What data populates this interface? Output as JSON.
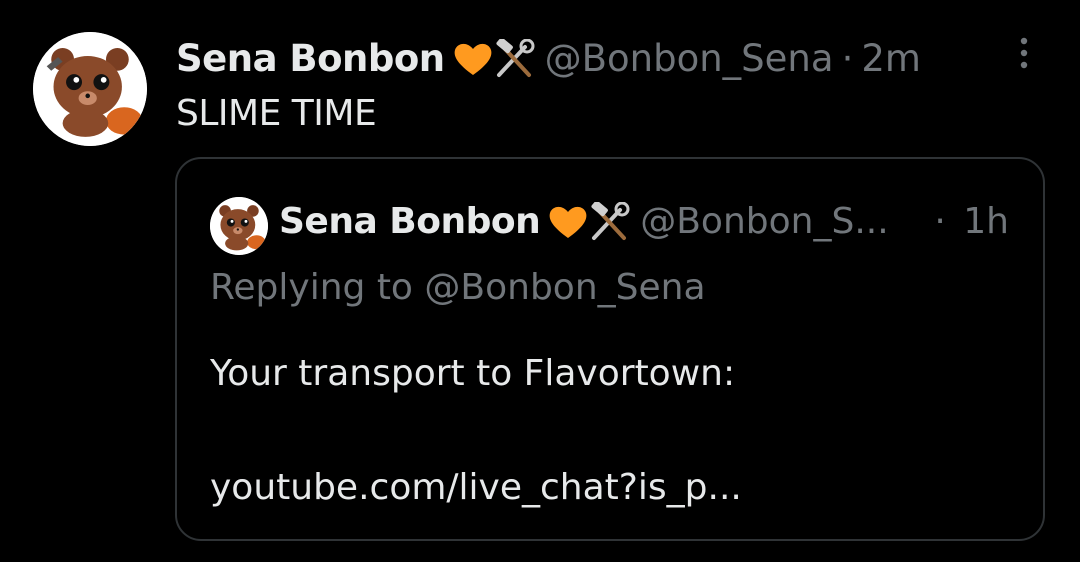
{
  "tweet": {
    "display_name": "Sena Bonbon",
    "handle": "@Bonbon_Sena",
    "separator": "·",
    "time": "2m",
    "text": "SLIME TIME",
    "avatar_icon": "bear-avatar-icon",
    "more_icon": "more-vertical-icon"
  },
  "quote": {
    "display_name": "Sena Bonbon",
    "handle": "@Bonbon_S...",
    "separator": "·",
    "time": "1h",
    "replying_to": "Replying to @Bonbon_Sena",
    "body": "Your transport to Flavortown:",
    "link": "youtube.com/live_chat?is_p...",
    "avatar_icon": "bear-avatar-icon"
  },
  "emojis": [
    "orange-heart-icon",
    "hammer-and-wrench-icon"
  ],
  "colors": {
    "background": "#000000",
    "primary_text": "#e7e9ea",
    "secondary_text": "#71767b",
    "border": "#2f3336",
    "heart": "#ff9a1f",
    "avatar_fur": "#8a4a2a"
  }
}
